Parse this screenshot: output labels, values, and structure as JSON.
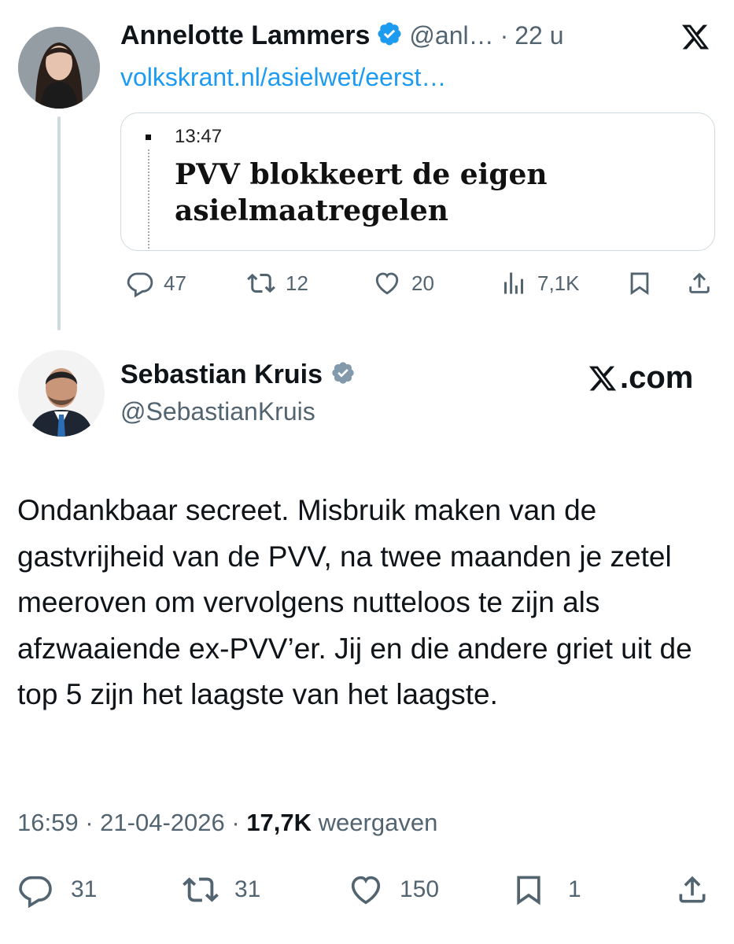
{
  "first_tweet": {
    "author_name": "Annelotte Lammers",
    "handle_truncated": "@anl…",
    "separator": "·",
    "time_ago": "22 u",
    "link_text": "volkskrant.nl/asielwet/eerst…",
    "card": {
      "time": "13:47",
      "headline_line1": "PVV blokkeert de eigen",
      "headline_line2": "asielmaatregelen"
    },
    "actions": {
      "replies": "47",
      "reposts": "12",
      "likes": "20",
      "views": "7,1K"
    }
  },
  "second_tweet": {
    "author_name": "Sebastian Kruis",
    "handle": "@SebastianKruis",
    "brand": "X.com",
    "body": "Ondankbaar secreet. Misbruik maken van de gastvrijheid van de PVV, na twee maanden je zetel meeroven om vervolgens nutteloos te zijn als afzwaaiende ex-PVV’er. Jij en die andere griet uit de top 5 zijn het laagste van het laagste.",
    "meta": {
      "time": "16:59",
      "date": "21-04-2026",
      "views_count": "17,7K",
      "views_label": "weergaven",
      "sep1": "·",
      "sep2": "·"
    },
    "actions": {
      "replies": "31",
      "reposts": "31",
      "likes": "150",
      "bookmarks": "1"
    }
  },
  "colors": {
    "verified": "#1d9bf0",
    "verified_gray": "#829aab",
    "link": "#1d9bf0",
    "muted": "#536471",
    "border": "#cfd9de"
  },
  "icons": [
    "x-logo-icon",
    "verified-icon",
    "reply-icon",
    "repost-icon",
    "like-icon",
    "views-icon",
    "bookmark-icon",
    "share-icon"
  ]
}
